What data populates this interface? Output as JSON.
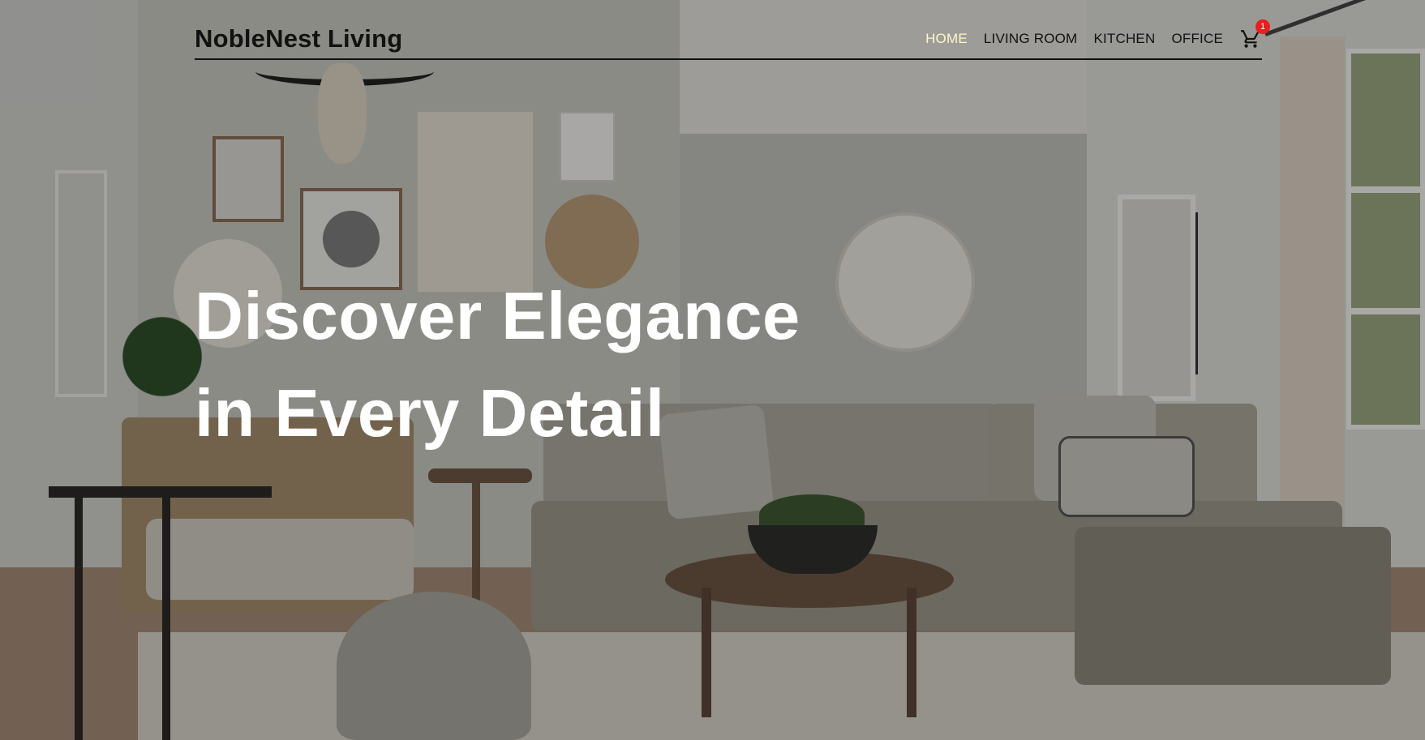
{
  "brand": {
    "name": "NobleNest Living"
  },
  "nav": {
    "items": [
      {
        "label": "HOME",
        "active": true
      },
      {
        "label": "LIVING ROOM",
        "active": false
      },
      {
        "label": "KITCHEN",
        "active": false
      },
      {
        "label": "OFFICE",
        "active": false
      }
    ],
    "cart": {
      "icon": "shopping-cart-icon",
      "count": "1"
    }
  },
  "hero": {
    "headline_line1": "Discover Elegance",
    "headline_line2": "in Every Detail",
    "background_image": "living-room-photo"
  },
  "colors": {
    "active_nav": "#fbf7c7",
    "badge": "#e5201e",
    "headline": "#ffffff",
    "text_dark": "#111111"
  }
}
